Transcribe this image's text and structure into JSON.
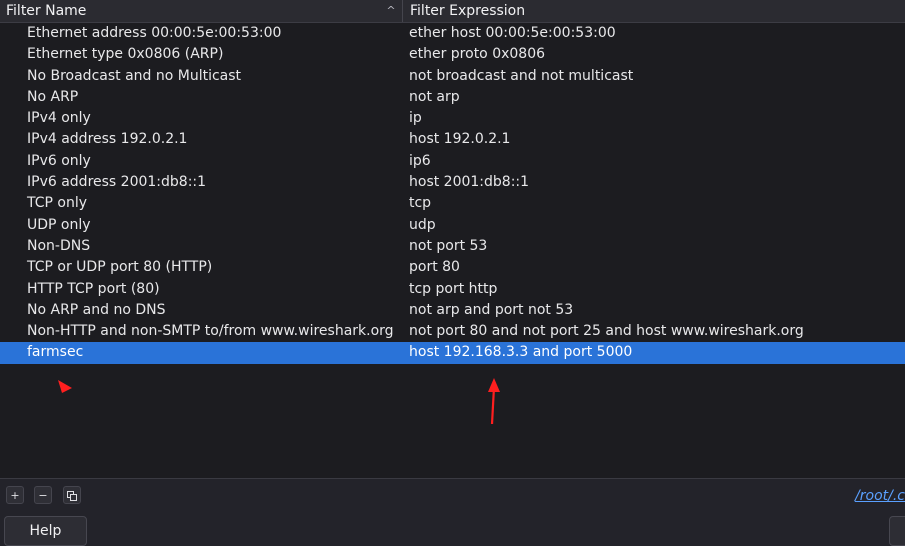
{
  "header": {
    "col_name": "Filter Name",
    "col_expr": "Filter Expression",
    "sort_glyph": "^"
  },
  "filters": [
    {
      "name": "Ethernet address 00:00:5e:00:53:00",
      "expr": "ether host 00:00:5e:00:53:00"
    },
    {
      "name": "Ethernet type 0x0806 (ARP)",
      "expr": "ether proto 0x0806"
    },
    {
      "name": "No Broadcast and no Multicast",
      "expr": "not broadcast and not multicast"
    },
    {
      "name": "No ARP",
      "expr": "not arp"
    },
    {
      "name": "IPv4 only",
      "expr": "ip"
    },
    {
      "name": "IPv4 address 192.0.2.1",
      "expr": "host 192.0.2.1"
    },
    {
      "name": "IPv6 only",
      "expr": "ip6"
    },
    {
      "name": "IPv6 address 2001:db8::1",
      "expr": "host 2001:db8::1"
    },
    {
      "name": "TCP only",
      "expr": "tcp"
    },
    {
      "name": "UDP only",
      "expr": "udp"
    },
    {
      "name": "Non-DNS",
      "expr": "not port 53"
    },
    {
      "name": "TCP or UDP port 80 (HTTP)",
      "expr": "port 80"
    },
    {
      "name": "HTTP TCP port (80)",
      "expr": "tcp port http"
    },
    {
      "name": "No ARP and no DNS",
      "expr": "not arp and port not 53"
    },
    {
      "name": "Non-HTTP and non-SMTP to/from www.wireshark.org",
      "expr": "not port 80 and not port 25 and host www.wireshark.org"
    },
    {
      "name": "farmsec",
      "expr": "host 192.168.3.3 and port 5000",
      "selected": true
    }
  ],
  "toolbar": {
    "add_label": "+",
    "remove_label": "−",
    "copy_icon": "copy-icon",
    "path_text": "/root/.c"
  },
  "footer": {
    "help_label": "Help"
  },
  "colors": {
    "selection": "#2a73d8",
    "annotation_arrow": "#ff1f1f",
    "link": "#5aa0ff"
  }
}
